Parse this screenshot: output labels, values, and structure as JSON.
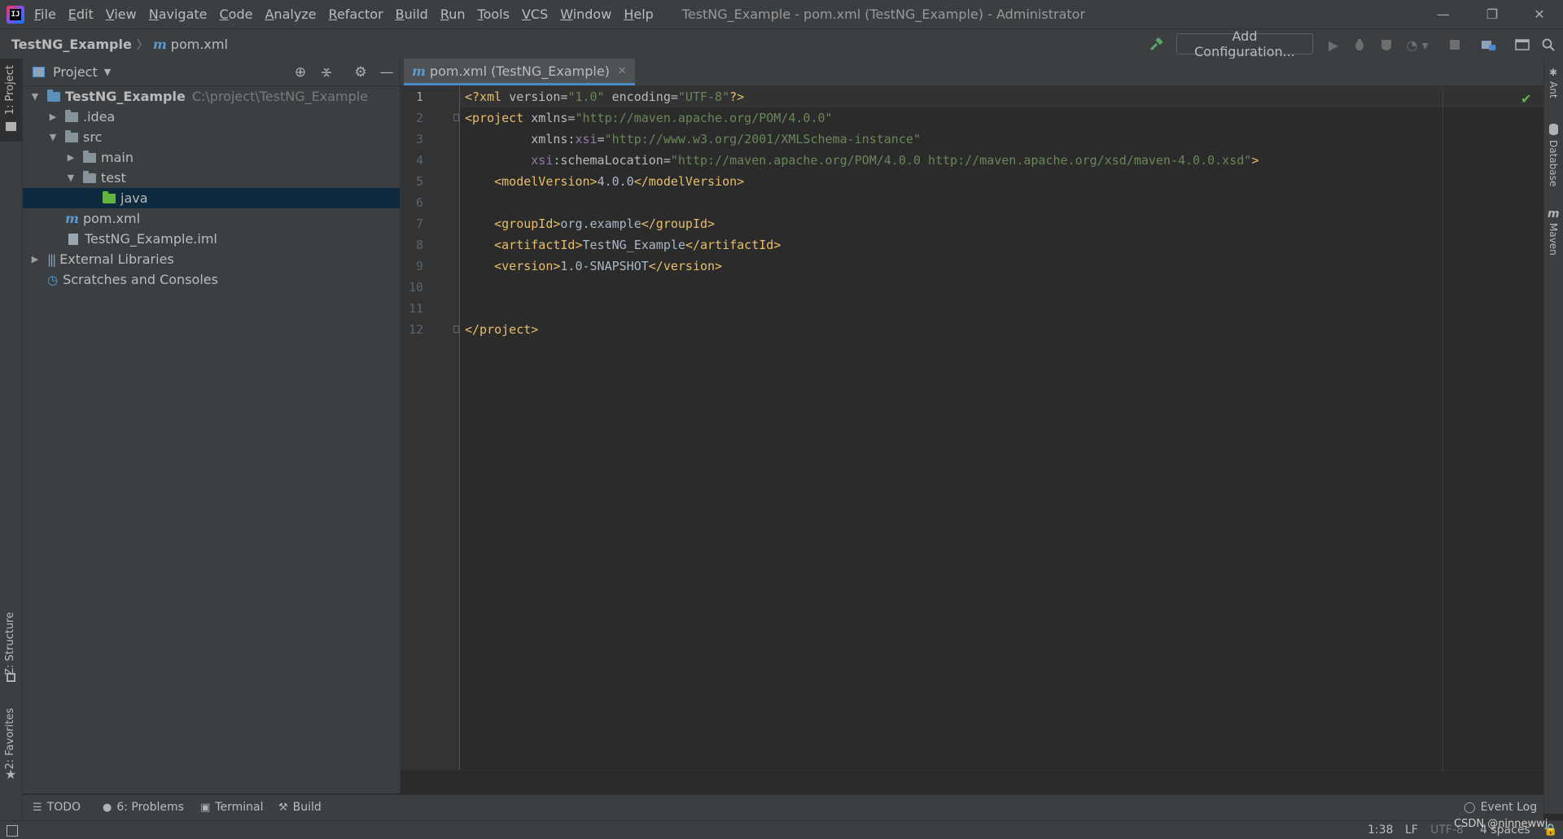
{
  "window": {
    "title": "TestNG_Example - pom.xml (TestNG_Example) - Administrator",
    "minimize": "—",
    "restore": "❐",
    "close": "✕"
  },
  "menu": [
    "File",
    "Edit",
    "View",
    "Navigate",
    "Code",
    "Analyze",
    "Refactor",
    "Build",
    "Run",
    "Tools",
    "VCS",
    "Window",
    "Help"
  ],
  "navbar": {
    "project": "TestNG_Example",
    "file": "pom.xml",
    "file_icon": "m",
    "add_configuration": "Add Configuration..."
  },
  "left_strip": {
    "project_tab": "1: Project",
    "structure_tab": "Z: Structure",
    "favorites_tab": "2: Favorites"
  },
  "right_strip": {
    "ant": "Ant",
    "database": "Database",
    "maven": "Maven"
  },
  "project_panel": {
    "title": "Project",
    "tree": [
      {
        "label": "TestNG_Example",
        "hint": "C:\\project\\TestNG_Example"
      },
      {
        "label": ".idea"
      },
      {
        "label": "src"
      },
      {
        "label": "main"
      },
      {
        "label": "test"
      },
      {
        "label": "java"
      },
      {
        "label": "pom.xml"
      },
      {
        "label": "TestNG_Example.iml"
      },
      {
        "label": "External Libraries"
      },
      {
        "label": "Scratches and Consoles"
      }
    ]
  },
  "editor": {
    "tab_label": "pom.xml (TestNG_Example)",
    "line_numbers": [
      "1",
      "2",
      "3",
      "4",
      "5",
      "6",
      "7",
      "8",
      "9",
      "10",
      "11",
      "12"
    ],
    "lines": {
      "l1": {
        "open": "<?xml ",
        "a1": "version=",
        "v1": "\"1.0\"",
        "a2": " encoding=",
        "v2": "\"UTF-8\"",
        "close": "?>"
      },
      "l2": {
        "open": "<project ",
        "a1": "xmlns=",
        "v1": "\"http://maven.apache.org/POM/4.0.0\""
      },
      "l3": {
        "indent": "         ",
        "a1": "xmlns:",
        "ns": "xsi",
        "eq": "=",
        "v1": "\"http://www.w3.org/2001/XMLSchema-instance\""
      },
      "l4": {
        "indent": "         ",
        "ns": "xsi",
        "a1": ":schemaLocation=",
        "v1": "\"http://maven.apache.org/POM/4.0.0 http://maven.apache.org/xsd/maven-4.0.0.xsd\"",
        "close": ">"
      },
      "l5": {
        "indent": "    ",
        "open": "<modelVersion>",
        "text": "4.0.0",
        "close": "</modelVersion>"
      },
      "l7": {
        "indent": "    ",
        "open": "<groupId>",
        "text": "org.example",
        "close": "</groupId>"
      },
      "l8": {
        "indent": "    ",
        "open": "<artifactId>",
        "text": "TestNG_Example",
        "close": "</artifactId>"
      },
      "l9": {
        "indent": "    ",
        "open": "<version>",
        "text": "1.0-SNAPSHOT",
        "close": "</version>"
      },
      "l12": {
        "close": "</project>"
      }
    }
  },
  "bottom_tools": {
    "todo": "TODO",
    "problems": "6: Problems",
    "terminal": "Terminal",
    "build": "Build",
    "event_log": "Event Log"
  },
  "status": {
    "position": "1:38",
    "line_sep": "LF",
    "encoding": "UTF-8",
    "indent": "4 spaces",
    "watermark": "CSDN @ninnewwj"
  },
  "colors": {
    "accent": "#4a88c7",
    "selection": "#0d293e",
    "tag": "#e8bf6a",
    "string": "#6a8759"
  }
}
